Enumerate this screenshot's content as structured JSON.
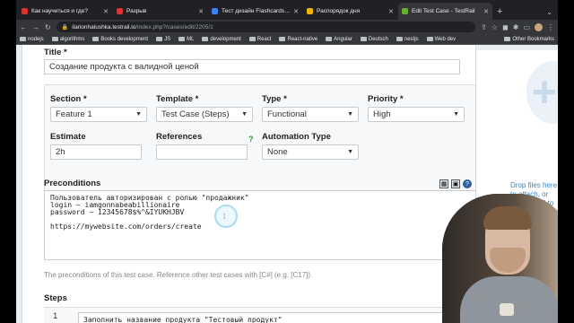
{
  "browser": {
    "tabs": [
      {
        "title": "Как научиться и где?",
        "favicon_color": "#db3236",
        "active": false
      },
      {
        "title": "Разрыв",
        "favicon_color": "#db3236",
        "active": false
      },
      {
        "title": "Тест дизайн Flashcards | Q...",
        "favicon_color": "#3c82f6",
        "active": false
      },
      {
        "title": "Распорядок дня",
        "favicon_color": "#f4b400",
        "active": false
      },
      {
        "title": "Edit Test Case - TestRail",
        "favicon_color": "#65b12f",
        "active": true
      }
    ],
    "url_host": "ilarionhalushka.testrail.io",
    "url_path": "/index.php?/cases/edit/2205/1",
    "bookmarks": [
      "nodejs",
      "algorithms",
      "Books development",
      "JS",
      "ML",
      "development",
      "React",
      "React-native",
      "Angular",
      "Deutsch",
      "nestjs",
      "Web dev"
    ],
    "other_bookmarks": "Other Bookmarks"
  },
  "form": {
    "title_label": "Title *",
    "title_value": "Создание продукта с валидной ценой",
    "section_label": "Section *",
    "section_value": "Feature 1",
    "template_label": "Template *",
    "template_value": "Test Case (Steps)",
    "type_label": "Type *",
    "type_value": "Functional",
    "priority_label": "Priority *",
    "priority_value": "High",
    "estimate_label": "Estimate",
    "estimate_value": "2h",
    "references_label": "References",
    "references_value": "",
    "references_help": "?",
    "automation_label": "Automation Type",
    "automation_value": "None",
    "preconditions_label": "Preconditions",
    "preconditions_text": "Пользователь авторизирован с ролью \"продажник\"\nlogin – iamgonnabeabillionaire\npassword – 12345678$%^&IYUKHJBV\n\nhttps://mywebsite.com/orders/create",
    "preconditions_hint": "The preconditions of this test case. Reference other test cases with [C#] (e.g. [C17]).",
    "steps_label": "Steps",
    "step_number": "1",
    "step_text": "Заполнить название продукта \"Тестовый продукт\""
  },
  "sidebar": {
    "drop_text": "Drop files here to attach, or click on \"+\" to browse"
  },
  "colors": {
    "link_blue": "#3b86c6",
    "help_green": "#3a8e3a",
    "grammarly": "#15c39a"
  }
}
